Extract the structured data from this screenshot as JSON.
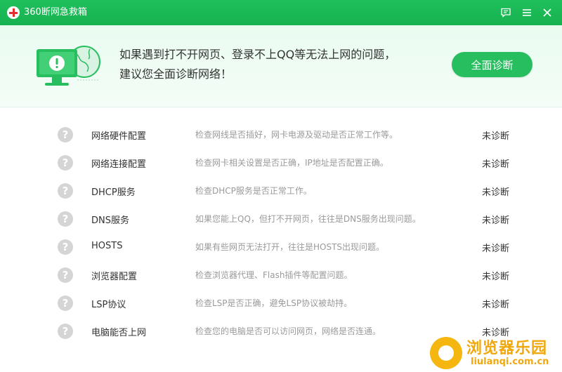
{
  "window": {
    "title": "360断网急救箱"
  },
  "banner": {
    "line1": "如果遇到打不开网页、登录不上QQ等无法上网的问题，",
    "line2": "建议您全面诊断网络！",
    "diagnose_label": "全面诊断"
  },
  "items": [
    {
      "name": "网络硬件配置",
      "desc": "检查网线是否插好，网卡电源及驱动是否正常工作等。",
      "status": "未诊断"
    },
    {
      "name": "网络连接配置",
      "desc": "检查网卡相关设置是否正确，IP地址是否配置正确。",
      "status": "未诊断"
    },
    {
      "name": "DHCP服务",
      "desc": "检查DHCP服务是否正常工作。",
      "status": "未诊断"
    },
    {
      "name": "DNS服务",
      "desc": "如果您能上QQ，但打不开网页，往往是DNS服务出现问题。",
      "status": "未诊断"
    },
    {
      "name": "HOSTS",
      "desc": "如果有些网页无法打开，往往是HOSTS出现问题。",
      "status": "未诊断"
    },
    {
      "name": "浏览器配置",
      "desc": "检查浏览器代理、Flash插件等配置问题。",
      "status": "未诊断"
    },
    {
      "name": "LSP协议",
      "desc": "检查LSP是否正确，避免LSP协议被劫持。",
      "status": "未诊断"
    },
    {
      "name": "电脑能否上网",
      "desc": "检查您的电脑是否可以访问网页，网络是否连通。",
      "status": "未诊断"
    }
  ],
  "watermark": {
    "name": "浏览器乐园",
    "url": "liulanqi.com.cn"
  },
  "colors": {
    "accent": "#27be5f",
    "titlebar": "#1bb955",
    "unknown_icon": "#d5d5d5",
    "watermark": "#f0a80c"
  }
}
